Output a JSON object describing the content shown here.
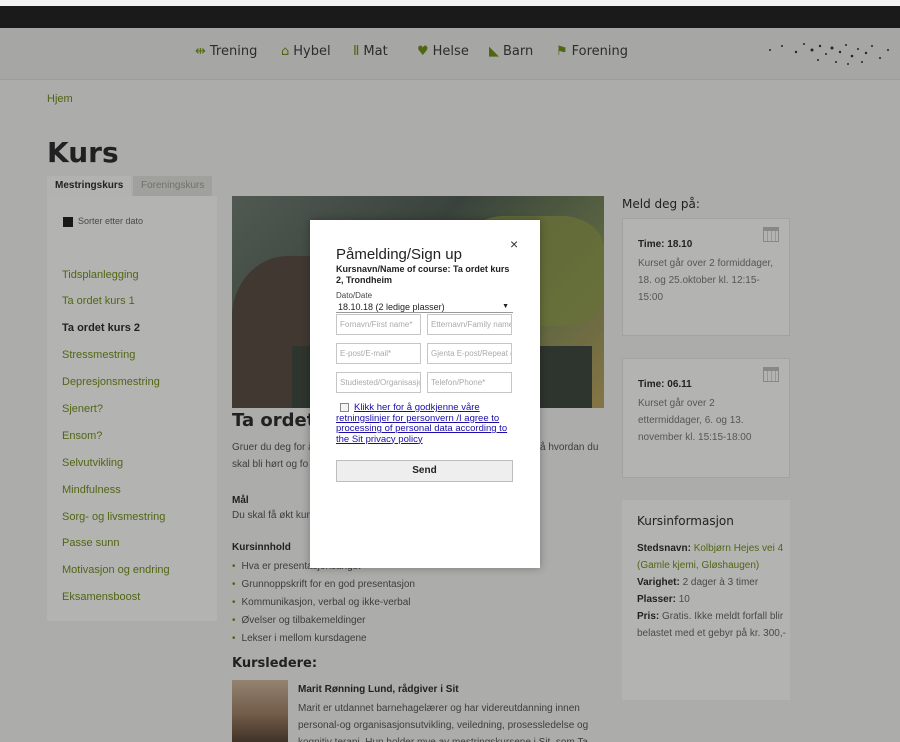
{
  "nav": {
    "items": [
      {
        "icon": "arrows-icon",
        "glyph": "⇹",
        "label": "Trening"
      },
      {
        "icon": "house-icon",
        "glyph": "⌂",
        "label": "Hybel"
      },
      {
        "icon": "cutlery-icon",
        "glyph": "Ⅱ",
        "label": "Mat"
      },
      {
        "icon": "heart-icon",
        "glyph": "♥",
        "label": "Helse"
      },
      {
        "icon": "stroller-icon",
        "glyph": "◣",
        "label": "Barn"
      },
      {
        "icon": "flag-icon",
        "glyph": "⚑",
        "label": "Forening"
      }
    ]
  },
  "breadcrumb": "Hjem",
  "page_title": "Kurs",
  "tabs": {
    "active": "Mestringskurs",
    "inactive": "Foreningskurs"
  },
  "sidebar": {
    "sort_label": "Sorter etter dato",
    "items": [
      "Tidsplanlegging",
      "Ta ordet kurs 1",
      "Ta ordet kurs 2",
      "Stressmestring",
      "Depresjonsmestring",
      "Sjenert?",
      "Ensom?",
      "Selvutvikling",
      "Mindfulness",
      "Sorg- og livsmestring",
      "Passe sunn",
      "Motivasjon og endring",
      "Eksamensboost"
    ],
    "current_index": 2
  },
  "content": {
    "title": "Ta ordet k",
    "intro_left": "Gruer du deg for å",
    "intro_right": "å hvordan du",
    "intro_line2": "skal bli hørt og fo",
    "mal_heading": "Mål",
    "mal_text": "Du skal få økt kur",
    "kursinnhold_heading": "Kursinnhold",
    "bullets": [
      "Hva er presentasjonsangst",
      "Grunnoppskrift for en god presentasjon",
      "Kommunikasjon, verbal og ikke-verbal",
      "Øvelser og tilbakemeldinger",
      "Lekser i mellom kursdagene"
    ],
    "kursledere": "Kursledere:",
    "teacher_name": "Marit Rønning Lund, rådgiver i Sit",
    "teacher_bio": "Marit er utdannet barnehagelærer og har videreutdanning innen personal-og organisasjonsutvikling, veiledning, prosessledelse og kognitiv terapi. Hun holder mye av mestringskursene i Sit, som Ta"
  },
  "meld": {
    "title": "Meld deg på:",
    "cards": [
      {
        "label": "Time: 18.10",
        "body": "Kurset går over 2 formiddager, 18. og 25.oktober kl. 12:15-15:00"
      },
      {
        "label": "Time: 06.11",
        "body": "Kurset går over 2 ettermiddager, 6. og 13. november kl. 15:15-18:00"
      }
    ]
  },
  "info": {
    "title": "Kursinformasjon",
    "sted_label": "Stedsnavn:",
    "sted_value": "Kolbjørn Hejes vei 4 (Gamle kjemi, Gløshaugen)",
    "varighet_label": "Varighet:",
    "varighet_value": "2 dager à 3 timer",
    "plasser_label": "Plasser:",
    "plasser_value": "10",
    "pris_label": "Pris:",
    "pris_value": "Gratis. Ikke meldt forfall blir belastet med et gebyr på kr. 300,-"
  },
  "modal": {
    "title": "Påmelding/Sign up",
    "close": "×",
    "course": "Kursnavn/Name of course: Ta ordet kurs 2, Trondheim",
    "date_label": "Dato/Date",
    "date_selected": "18.10.18 (2 ledige plasser)",
    "fields": {
      "first_name": "Fornavn/First name*",
      "last_name": "Etternavn/Family name*",
      "email": "E-post/E-mail*",
      "email_repeat": "Gjenta E-post/Repeat e-mail*",
      "studiested": "Studiested/Organisasjon",
      "phone": "Telefon/Phone*"
    },
    "consent": "Klikk her for å godkjenne våre retningslinjer for personvern /I agree to processing of personal data according to the Sit privacy policy",
    "send": "Send"
  }
}
